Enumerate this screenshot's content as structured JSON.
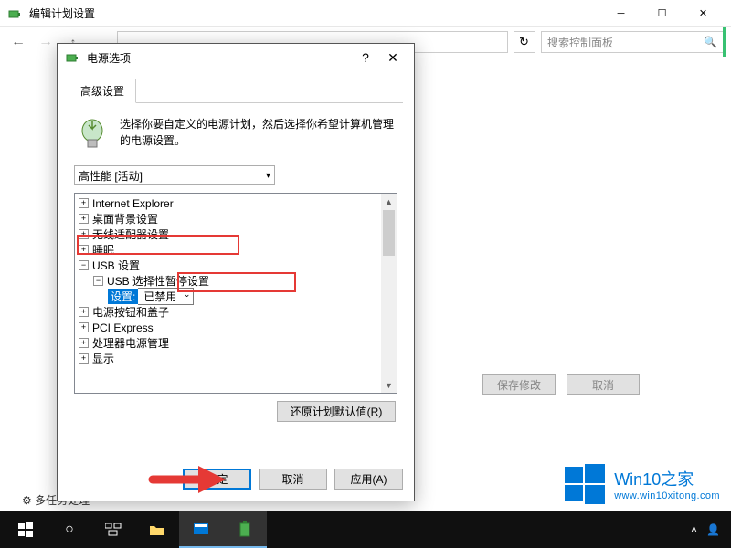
{
  "parent": {
    "title": "编辑计划设置",
    "search_placeholder": "搜索控制面板",
    "save_button": "保存修改",
    "cancel_button": "取消",
    "bottom_link": "多任务处理"
  },
  "dialog": {
    "title": "电源选项",
    "tab_label": "高级设置",
    "info_text": "选择你要自定义的电源计划，然后选择你希望计算机管理的电源设置。",
    "plan_select": "高性能 [活动]",
    "tree": {
      "items": [
        {
          "label": "Internet Explorer",
          "depth": 0,
          "expanded": false
        },
        {
          "label": "桌面背景设置",
          "depth": 0,
          "expanded": false
        },
        {
          "label": "无线适配器设置",
          "depth": 0,
          "expanded": false
        },
        {
          "label": "睡眠",
          "depth": 0,
          "expanded": false
        },
        {
          "label": "USB 设置",
          "depth": 0,
          "expanded": true
        },
        {
          "label": "USB 选择性暂停设置",
          "depth": 1,
          "expanded": true
        },
        {
          "label_prefix": "设置:",
          "value": "已禁用",
          "depth": 2,
          "combo": true
        },
        {
          "label": "电源按钮和盖子",
          "depth": 0,
          "expanded": false
        },
        {
          "label": "PCI Express",
          "depth": 0,
          "expanded": false
        },
        {
          "label": "处理器电源管理",
          "depth": 0,
          "expanded": false
        },
        {
          "label": "显示",
          "depth": 0,
          "expanded": false
        }
      ]
    },
    "restore_defaults": "还原计划默认值(R)",
    "ok": "确定",
    "cancel": "取消",
    "apply": "应用(A)"
  },
  "watermark": {
    "line1": "Win10之家",
    "line2": "www.win10xitong.com"
  }
}
